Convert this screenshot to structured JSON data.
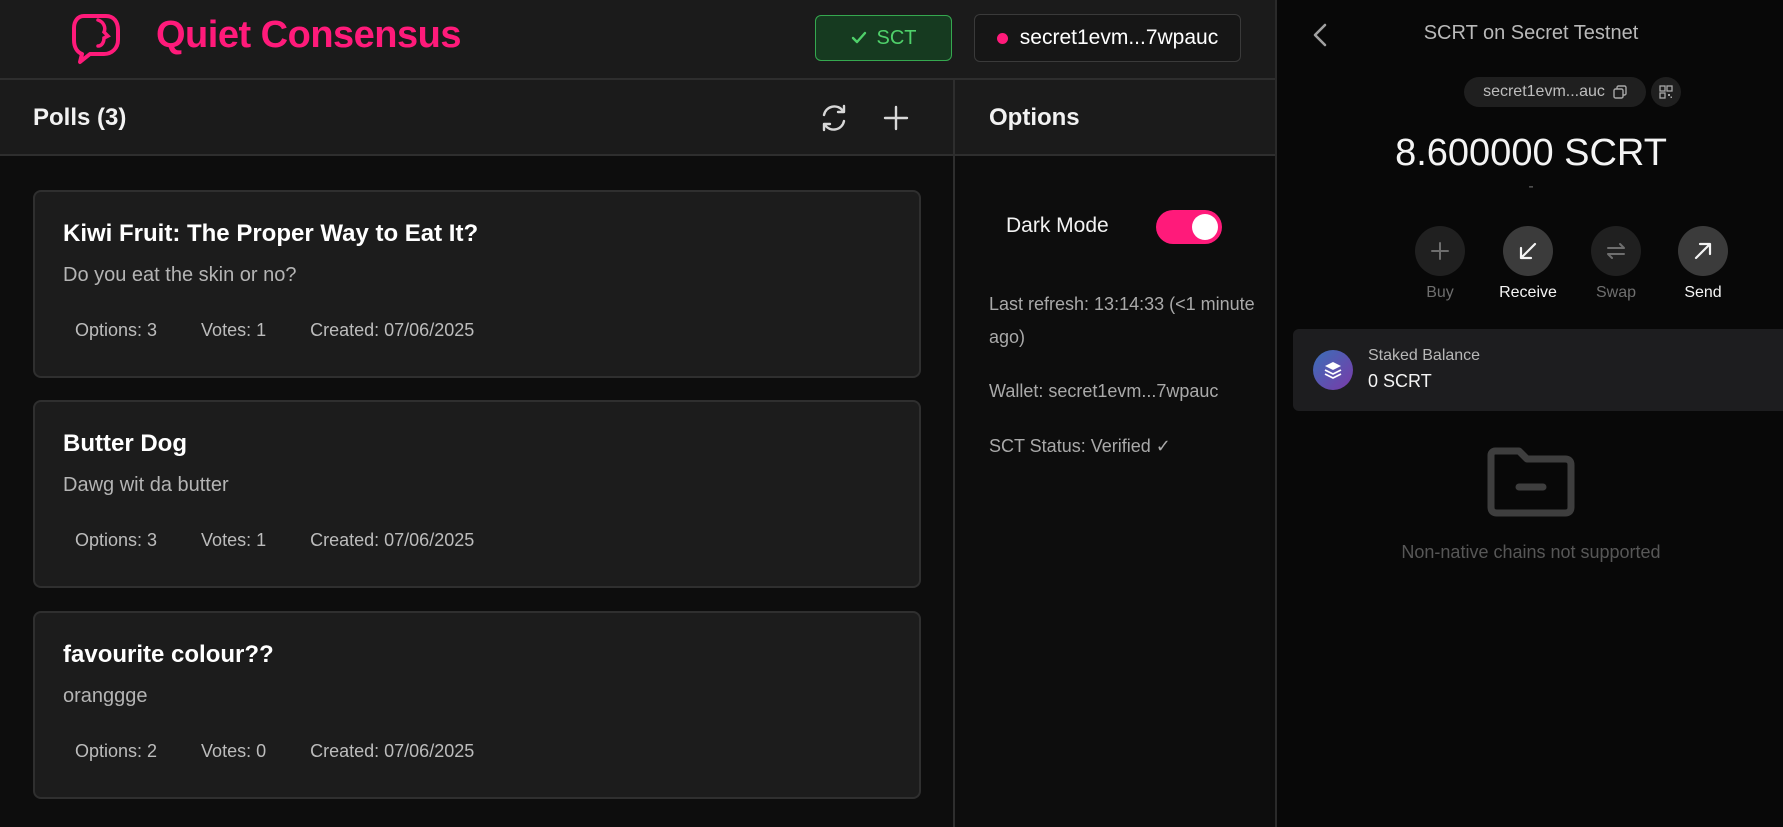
{
  "header": {
    "title": "Quiet Consensus",
    "sct_button": {
      "icon": "check-icon",
      "label": "SCT"
    },
    "wallet_button": {
      "label": "secret1evm...7wpauc"
    }
  },
  "polls": {
    "header_title": "Polls (3)",
    "items": [
      {
        "title": "Kiwi Fruit: The Proper Way to Eat It?",
        "description": "Do you eat the skin or no?",
        "options": "Options: 3",
        "votes": "Votes: 1",
        "created": "Created: 07/06/2025"
      },
      {
        "title": "Butter Dog",
        "description": "Dawg wit da butter",
        "options": "Options: 3",
        "votes": "Votes: 1",
        "created": "Created: 07/06/2025"
      },
      {
        "title": "favourite colour??",
        "description": "oranggge",
        "options": "Options: 2",
        "votes": "Votes: 0",
        "created": "Created: 07/06/2025"
      }
    ]
  },
  "options_panel": {
    "title": "Options",
    "dark_mode_label": "Dark Mode",
    "dark_mode_on": true,
    "last_refresh": "Last refresh: 13:14:33 (<1 minute ago)",
    "wallet": "Wallet: secret1evm...7wpauc",
    "sct_status": "SCT Status: Verified ✓"
  },
  "wallet_pane": {
    "title": "SCRT on Secret Testnet",
    "address_chip": "secret1evm...auc",
    "balance": "8.600000 SCRT",
    "balance_sub": "-",
    "actions": [
      {
        "label": "Buy",
        "icon": "plus-icon",
        "enabled": false
      },
      {
        "label": "Receive",
        "icon": "arrow-down-left-icon",
        "enabled": true
      },
      {
        "label": "Swap",
        "icon": "swap-icon",
        "enabled": false
      },
      {
        "label": "Send",
        "icon": "arrow-up-right-icon",
        "enabled": true
      }
    ],
    "staked_label": "Staked Balance",
    "staked_value": "0 SCRT",
    "non_native_note": "Non-native chains not supported"
  },
  "colors": {
    "brand": "#ff1a7a",
    "success": "#4fd06a"
  }
}
